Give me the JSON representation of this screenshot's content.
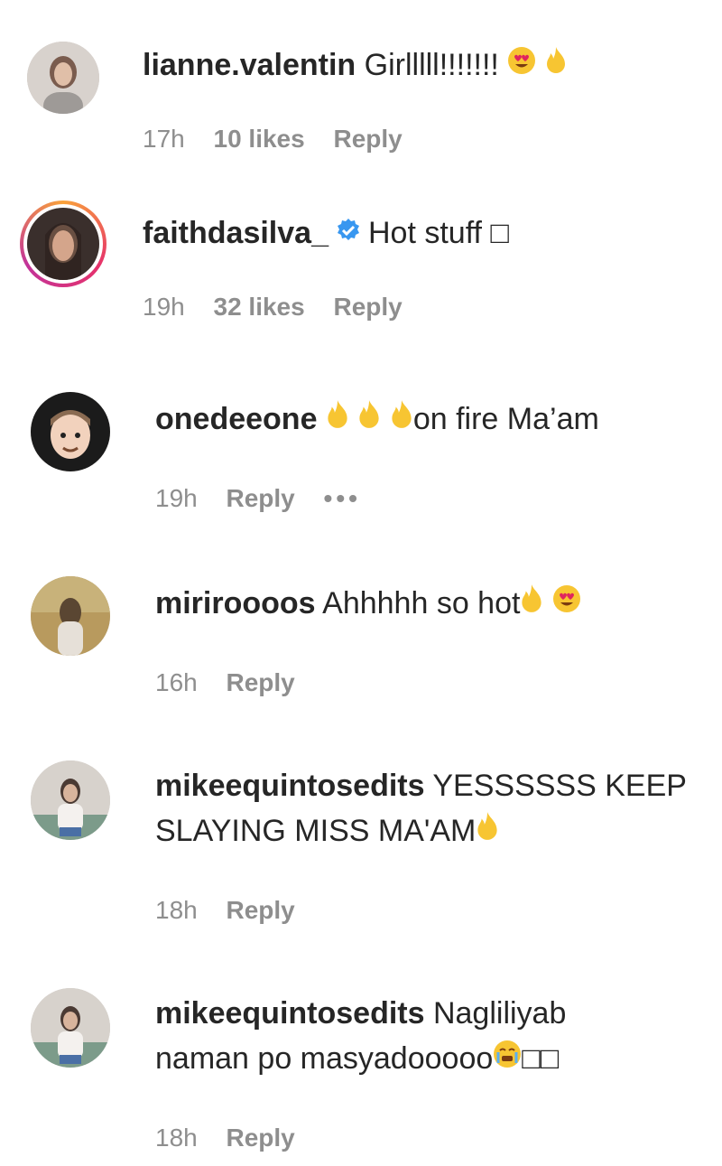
{
  "comments": [
    {
      "username": "lianne.valentin",
      "text": "Girlllll!!!!!!!",
      "time": "17h",
      "likes": "10 likes",
      "reply": "Reply",
      "avatar_color": "#bcb3ad"
    },
    {
      "username": "faithdasilva_",
      "verified": true,
      "text": "Hot stuff",
      "trailing_box": "□",
      "time": "19h",
      "likes": "32 likes",
      "reply": "Reply",
      "avatar_color": "#5a4a44",
      "story_ring": true
    },
    {
      "username": "onedeeone",
      "text": "on fire Ma’am",
      "time": "19h",
      "reply": "Reply",
      "more": "•••",
      "avatar_color": "#1f1f1f"
    },
    {
      "username": "miriroooos",
      "text": "Ahhhhh so hot",
      "time": "16h",
      "reply": "Reply",
      "avatar_color": "#b9a16b"
    },
    {
      "username": "mikeequintosedits",
      "text_line1": "YESSSSSS KEEP",
      "text_line2": "SLAYING MISS MA'AM",
      "time": "18h",
      "reply": "Reply",
      "avatar_color": "#cfc8c2"
    },
    {
      "username": "mikeequintosedits",
      "text_line1": "Nagliliyab",
      "text_line2": "naman po masyadooooo",
      "trailing_boxes": "□□",
      "time": "18h",
      "reply": "Reply",
      "avatar_color": "#cfc8c2"
    }
  ],
  "icons": {
    "fire": "fire-emoji-icon",
    "heart_eyes": "heart-eyes-emoji-icon",
    "crying": "crying-emoji-icon",
    "verified": "verified-badge-icon"
  }
}
